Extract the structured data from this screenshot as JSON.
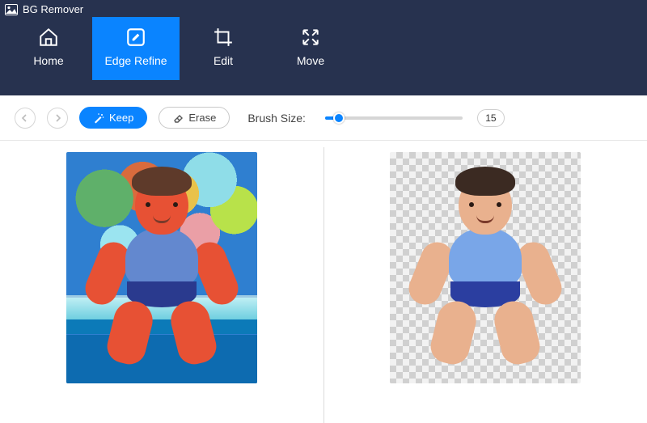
{
  "app": {
    "title": "BG Remover"
  },
  "tabs": [
    {
      "label": "Home"
    },
    {
      "label": "Edge Refine",
      "active": true
    },
    {
      "label": "Edit"
    },
    {
      "label": "Move"
    }
  ],
  "toolbar": {
    "keep_label": "Keep",
    "erase_label": "Erase",
    "brush_label": "Brush Size:",
    "brush_value": "15",
    "brush_pct": 10
  },
  "icons": {
    "app": "image-icon",
    "home": "home-icon",
    "edge_refine": "edit-square-icon",
    "edit": "crop-icon",
    "move": "expand-arrows-icon",
    "undo": "arrow-left-icon",
    "redo": "arrow-right-icon",
    "keep": "wand-icon",
    "erase": "eraser-icon"
  }
}
